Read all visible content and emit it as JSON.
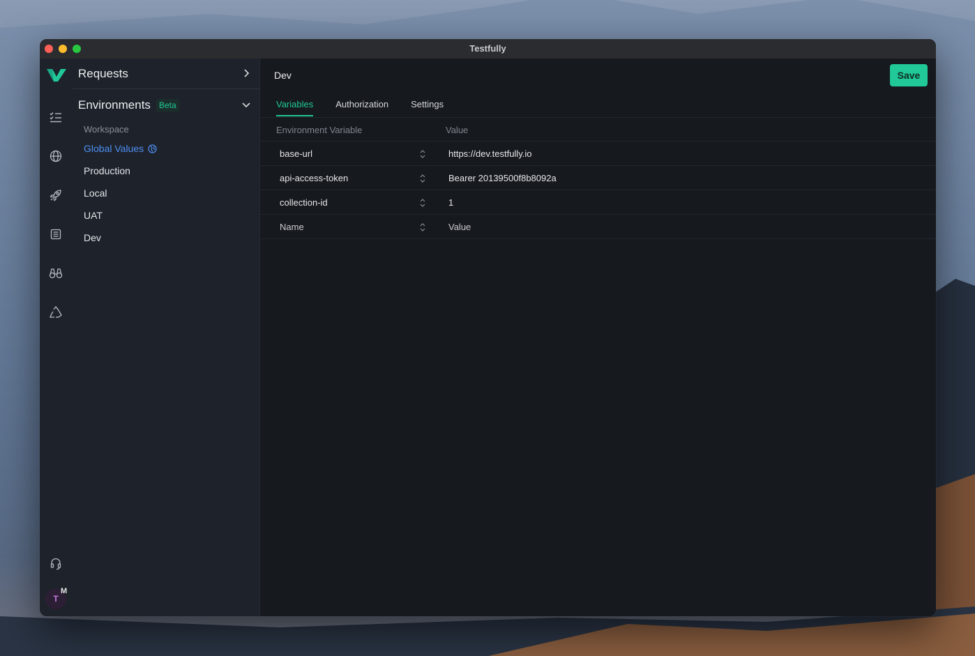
{
  "window": {
    "title": "Testfully"
  },
  "nav_icons": [
    "checklist-icon",
    "globe-icon",
    "rocket-icon",
    "document-list-icon",
    "binoculars-icon",
    "recycle-icon"
  ],
  "bottom": {
    "avatar_initial": "T",
    "badge": "M"
  },
  "sidebar": {
    "requests_title": "Requests",
    "environments_title": "Environments",
    "beta_label": "Beta",
    "section_label": "Workspace",
    "items": [
      {
        "label": "Global Values",
        "active": true
      },
      {
        "label": "Production"
      },
      {
        "label": "Local"
      },
      {
        "label": "UAT"
      },
      {
        "label": "Dev"
      }
    ]
  },
  "main": {
    "title": "Dev",
    "save_label": "Save",
    "tabs": [
      {
        "label": "Variables",
        "active": true
      },
      {
        "label": "Authorization"
      },
      {
        "label": "Settings"
      }
    ],
    "table": {
      "columns": [
        "Environment Variable",
        "Value"
      ],
      "rows": [
        {
          "name": "base-url",
          "value": "https://dev.testfully.io"
        },
        {
          "name": "api-access-token",
          "value": "Bearer 20139500f8b8092a"
        },
        {
          "name": "collection-id",
          "value": "1"
        }
      ],
      "new_row": {
        "name_placeholder": "Name",
        "value_placeholder": "Value"
      }
    }
  },
  "colors": {
    "accent": "#20c997",
    "link": "#4f8ff5",
    "bg": "#16191e",
    "sidebar_bg": "#1e232b"
  }
}
